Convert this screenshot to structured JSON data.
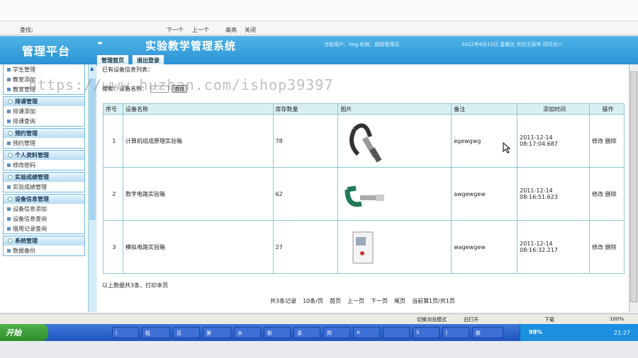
{
  "find_bar": {
    "label": "查找:",
    "next": "下一个",
    "prev": "上一个",
    "highlight": "高亮",
    "close": "关闭"
  },
  "app": {
    "logo": "管理平台",
    "toggle": "◂▸",
    "title": "实验教学管理系统",
    "user_info": "当前用户：heg  权限：超级管理员",
    "date": "2012年6月15日 星期五 农历壬辰年 四月廿八"
  },
  "tabs": [
    {
      "label": "管理首页"
    },
    {
      "label": "退出登录"
    }
  ],
  "sidebar": {
    "orphans": [
      "学生管理",
      "教室添加",
      "教室管理"
    ],
    "sections": [
      {
        "title": "排课管理",
        "items": [
          "排课添加",
          "排课查询"
        ]
      },
      {
        "title": "预约管理",
        "items": [
          "预约管理"
        ]
      },
      {
        "title": "个人资料管理",
        "items": [
          "修改密码"
        ]
      },
      {
        "title": "实验成绩管理",
        "items": [
          "实验成绩管理"
        ]
      },
      {
        "title": "设备信息管理",
        "items": [
          "设备信息添加",
          "设备信息查询",
          "借用记录查询"
        ]
      },
      {
        "title": "系统管理",
        "items": [
          "数据备份"
        ]
      }
    ]
  },
  "content": {
    "list_title": "已有设备信息列表：",
    "search_label": "搜索：设备名称：",
    "search_button": "查找",
    "watermark": "https://www.huzhan.com/ishop39397",
    "columns": [
      "序号",
      "设备名称",
      "库存数量",
      "图片",
      "备注",
      "添加时间",
      "操作"
    ],
    "rows": [
      {
        "no": "1",
        "name": "计算机组成原理实验箱",
        "qty": "78",
        "note": "egewgwg",
        "time": "2011-12-14 08:17:04.687",
        "edit": "修改",
        "delete": "删除"
      },
      {
        "no": "2",
        "name": "数字电路实验箱",
        "qty": "62",
        "note": "awgewgew",
        "time": "2011-12-14 08:16:51.623",
        "edit": "修改",
        "delete": "删除"
      },
      {
        "no": "3",
        "name": "模拟电路实验箱",
        "qty": "27",
        "note": "wagewgew",
        "time": "2011-12-14 08:16:32.217",
        "edit": "修改",
        "delete": "删除"
      }
    ],
    "summary": "以上数据共3条，打印本页",
    "pager": [
      "共3条记录",
      "10条/页",
      "首页",
      "上一页",
      "下一页",
      "尾页",
      "当前第1页/共1页"
    ]
  },
  "statusbar": {
    "mode": "切换浏览模式",
    "tab": "旧打开",
    "download": "下载",
    "zoom": "100%"
  },
  "taskbar": {
    "start": "开始",
    "buttons": [
      "j",
      "程",
      "百",
      "第",
      "水",
      "新",
      "录",
      "邦",
      "A",
      "",
      "S",
      "J",
      "数"
    ],
    "tray_percent": "98%",
    "clock": "21:27"
  }
}
